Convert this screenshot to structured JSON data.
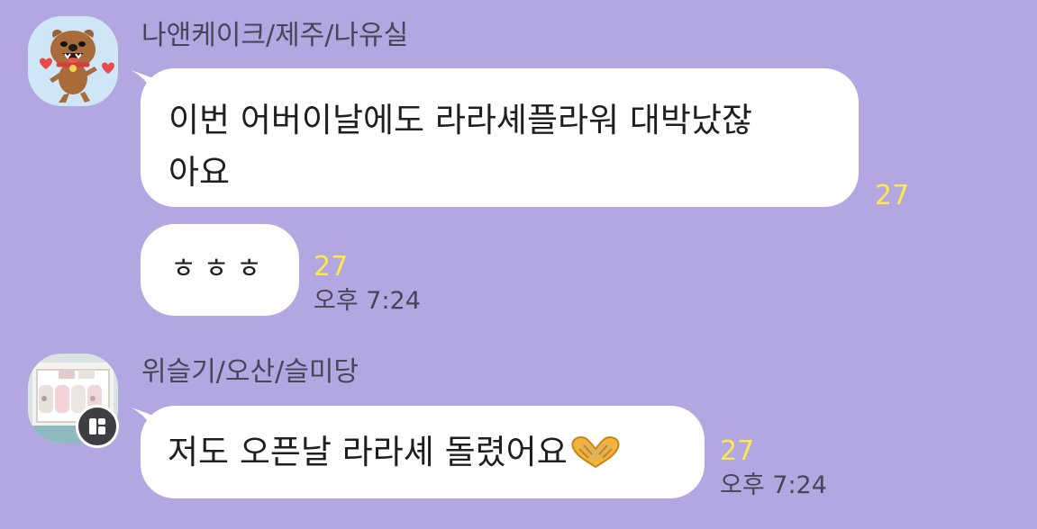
{
  "colors": {
    "chat_background": "#b2a7e0",
    "bubble_background": "#ffffff",
    "read_count_color": "#ffe84a"
  },
  "messages": [
    {
      "sender": "나앤케이크/제주/나유실",
      "avatar_icon": "brown-dog-character-avatar",
      "bubbles": [
        {
          "text_lines": [
            "이번 어버이날에도 라라셰플라워 대박났잖",
            "아요"
          ],
          "read_count": "27",
          "time": ""
        },
        {
          "text": "ㅎㅎㅎ",
          "read_count": "27",
          "time": "오후 7:24"
        }
      ]
    },
    {
      "sender": "위슬기/오산/슬미당",
      "avatar_icon": "bakery-box-photo-avatar",
      "bubbles": [
        {
          "text": "저도 오픈날 라라셰 돌렸어요",
          "emoji": "heart-hands-emoji",
          "read_count": "27",
          "time": "오후 7:24"
        }
      ]
    }
  ]
}
